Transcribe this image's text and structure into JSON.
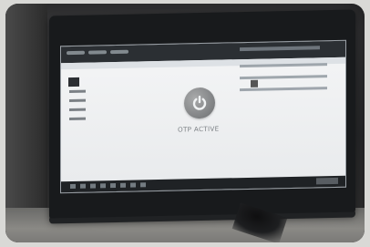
{
  "screen": {
    "status_text": "OTP ACTIVE"
  },
  "icons": {
    "power": "power-icon"
  }
}
